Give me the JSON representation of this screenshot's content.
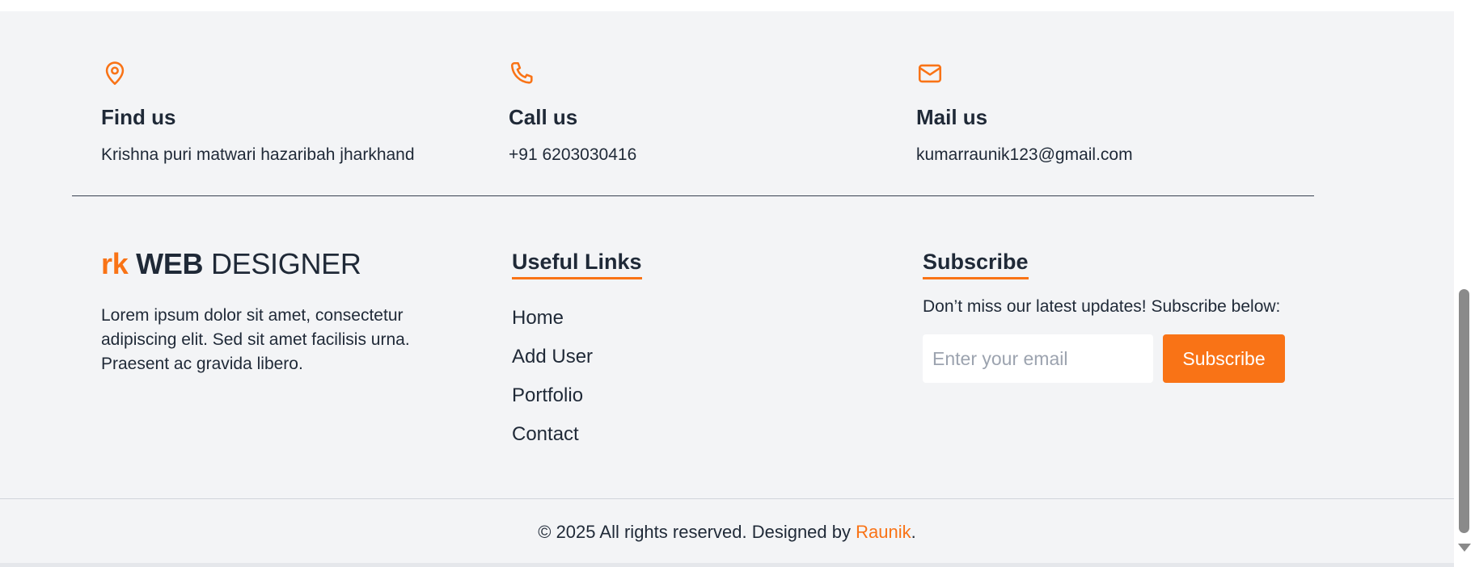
{
  "contacts": [
    {
      "icon": "map-pin-icon",
      "title": "Find us",
      "text": "Krishna puri matwari hazaribah jharkhand"
    },
    {
      "icon": "phone-icon",
      "title": "Call us",
      "text": "+91 6203030416"
    },
    {
      "icon": "mail-icon",
      "title": "Mail us",
      "text": "kumarraunik123@gmail.com"
    }
  ],
  "brand": {
    "prefix": "rk",
    "bold": "WEB",
    "light": "DESIGNER"
  },
  "about": "Lorem ipsum dolor sit amet, consectetur adipiscing elit. Sed sit amet facilisis urna. Praesent ac gravida libero.",
  "useful_links": {
    "title": "Useful Links",
    "items": [
      "Home",
      "Add User",
      "Portfolio",
      "Contact"
    ]
  },
  "subscribe": {
    "title": "Subscribe",
    "text": "Don’t miss our latest updates! Subscribe below:",
    "placeholder": "Enter your email",
    "button": "Subscribe"
  },
  "copyright": {
    "before": "© 2025 All rights reserved. Designed by ",
    "author": "Raunik",
    "after": "."
  },
  "colors": {
    "accent": "#f97316",
    "background": "#f3f4f6",
    "text": "#1f2937"
  }
}
